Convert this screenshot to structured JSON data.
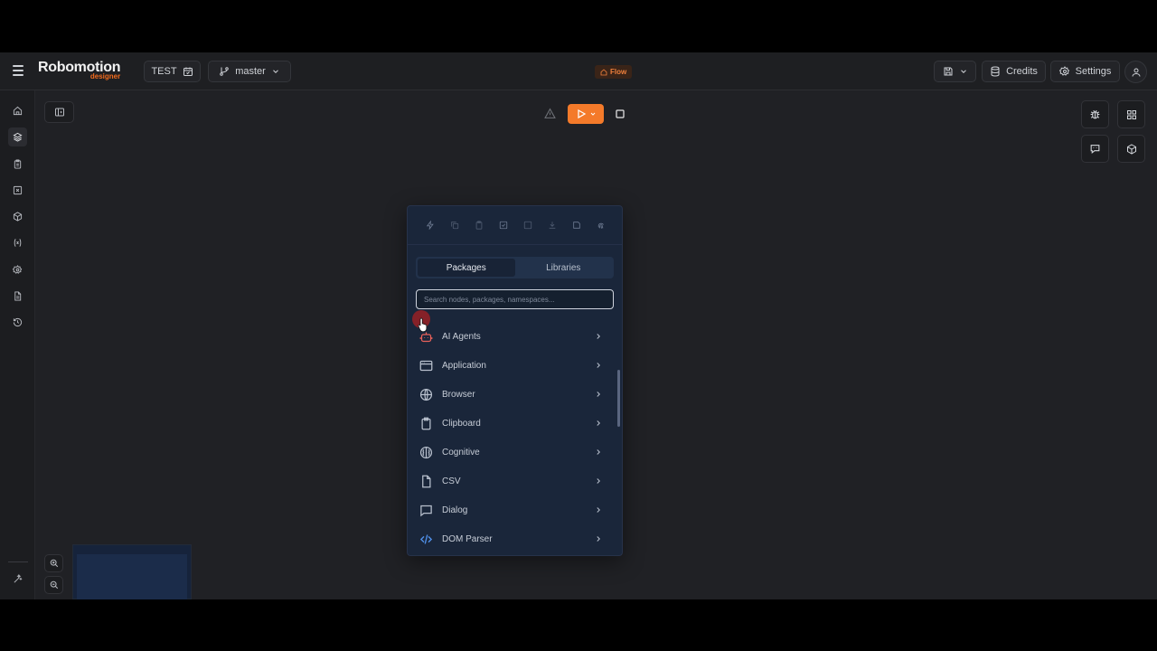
{
  "header": {
    "logo_main": "Robomotion",
    "logo_sub": "designer",
    "project_name": "TEST",
    "branch": "master",
    "flow_badge": "Flow",
    "credits_label": "Credits",
    "settings_label": "Settings"
  },
  "panel": {
    "tabs": [
      {
        "label": "Packages",
        "active": true
      },
      {
        "label": "Libraries",
        "active": false
      }
    ],
    "search_placeholder": "Search nodes, packages, namespaces...",
    "packages": [
      {
        "label": "AI Agents",
        "icon": "robot-icon",
        "color": "#e8615a"
      },
      {
        "label": "Application",
        "icon": "app-window-icon",
        "color": "#b8c0cd"
      },
      {
        "label": "Browser",
        "icon": "globe-icon",
        "color": "#b8c0cd"
      },
      {
        "label": "Clipboard",
        "icon": "clipboard-icon",
        "color": "#b8c0cd"
      },
      {
        "label": "Cognitive",
        "icon": "brain-icon",
        "color": "#b8c0cd"
      },
      {
        "label": "CSV",
        "icon": "file-icon",
        "color": "#b8c0cd"
      },
      {
        "label": "Dialog",
        "icon": "message-square-icon",
        "color": "#b8c0cd"
      },
      {
        "label": "DOM Parser",
        "icon": "code-icon",
        "color": "#4f8fe8"
      }
    ]
  },
  "colors": {
    "accent": "#f47a2a",
    "background": "#202125",
    "panel": "#1a263a"
  }
}
